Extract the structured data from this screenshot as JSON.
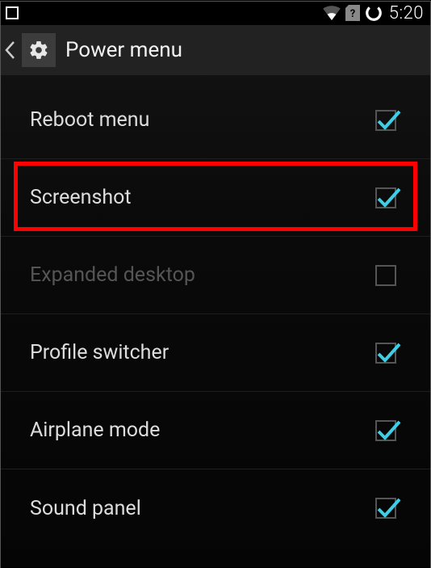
{
  "statusbar": {
    "time": "5:20"
  },
  "actionbar": {
    "title": "Power menu"
  },
  "items": [
    {
      "label": "Reboot menu",
      "checked": true,
      "disabled": false,
      "highlighted": false
    },
    {
      "label": "Screenshot",
      "checked": true,
      "disabled": false,
      "highlighted": true
    },
    {
      "label": "Expanded desktop",
      "checked": false,
      "disabled": true,
      "highlighted": false
    },
    {
      "label": "Profile switcher",
      "checked": true,
      "disabled": false,
      "highlighted": false
    },
    {
      "label": "Airplane mode",
      "checked": true,
      "disabled": false,
      "highlighted": false
    },
    {
      "label": "Sound panel",
      "checked": true,
      "disabled": false,
      "highlighted": false
    }
  ],
  "colors": {
    "accent": "#3bd0e8",
    "highlight": "#ff0000"
  }
}
